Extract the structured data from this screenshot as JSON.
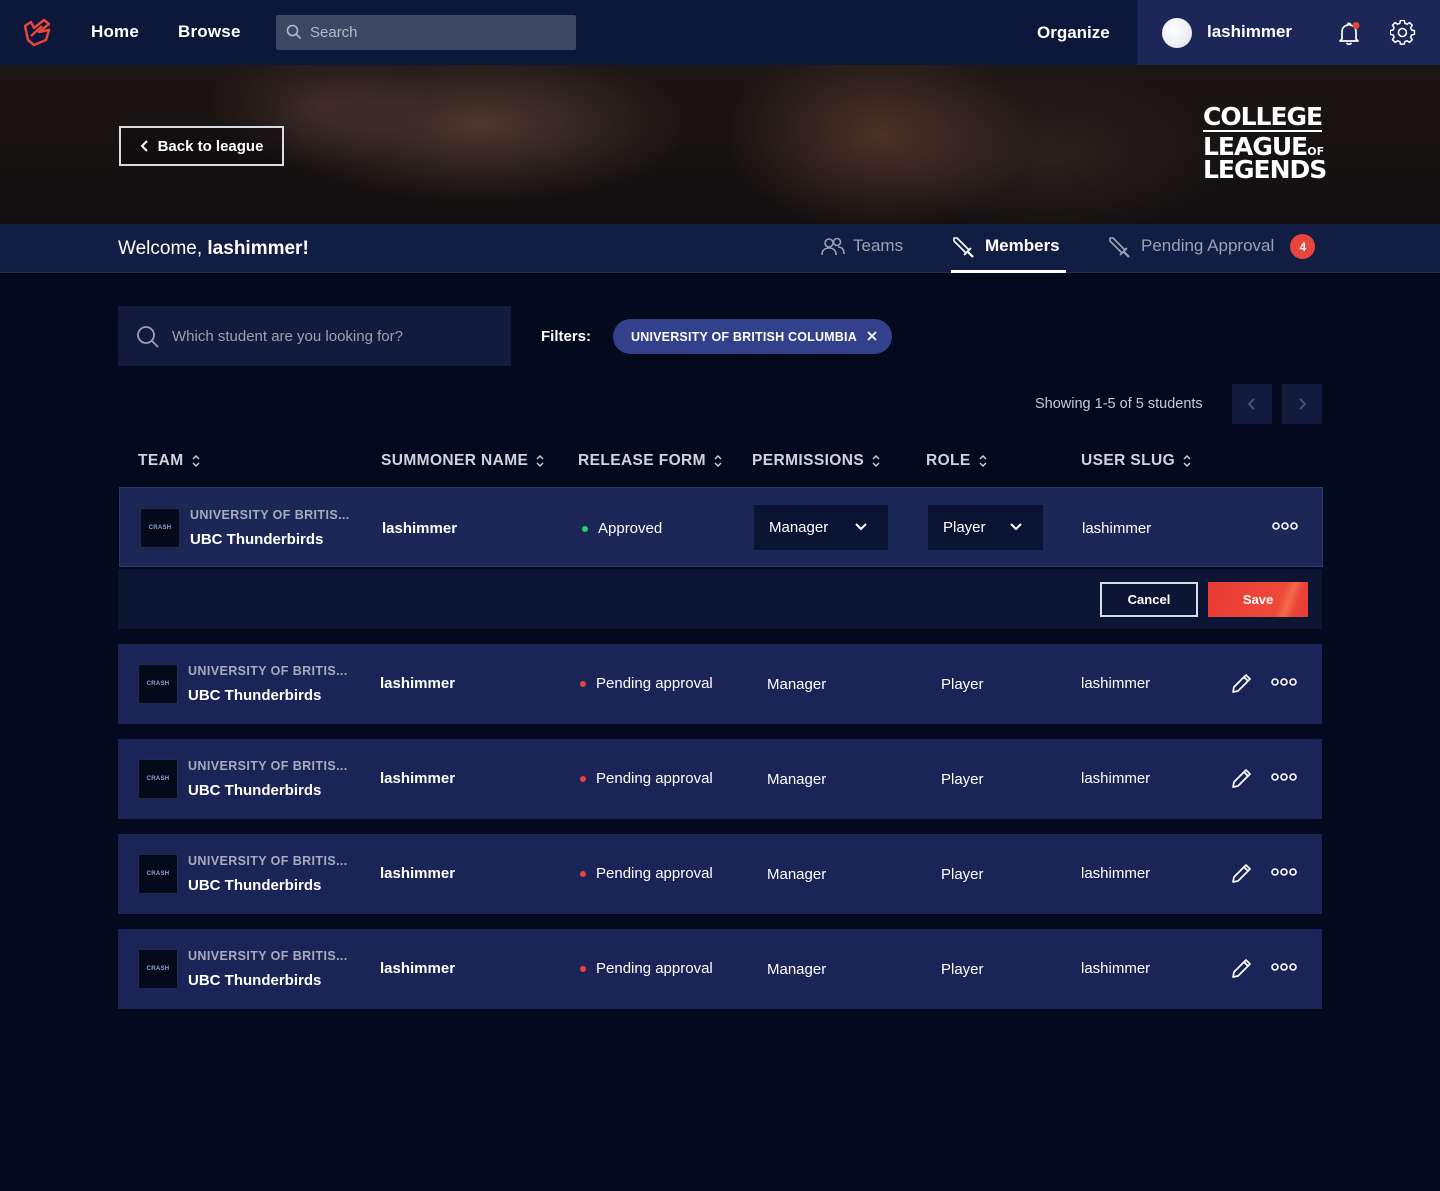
{
  "nav": {
    "logo_icon": "riot-fist-icon",
    "links": [
      "Home",
      "Browse"
    ],
    "search_placeholder": "Search",
    "organize": "Organize",
    "username": "lashimmer",
    "notification_dot_color": "#e8453c"
  },
  "banner": {
    "back_label": "Back to league",
    "logo_line1": "COLLEGE",
    "logo_line2": "LEAGUE",
    "logo_line2_small": "OF",
    "logo_line3": "LEGENDS"
  },
  "subheader": {
    "welcome_prefix": "Welcome, ",
    "welcome_name": "lashimmer",
    "welcome_suffix": "!",
    "tabs": [
      {
        "label": "Teams",
        "icon": "users-icon",
        "active": false
      },
      {
        "label": "Members",
        "icon": "sword-icon",
        "active": true
      },
      {
        "label": "Pending Approval",
        "icon": "sword-icon",
        "active": false,
        "badge": "4"
      }
    ]
  },
  "filters": {
    "search_placeholder": "Which student are you looking for?",
    "label": "Filters:",
    "chip": "UNIVERSITY OF BRITISH COLUMBIA",
    "showing": "Showing 1-5 of 5 students"
  },
  "table": {
    "headers": [
      "TEAM",
      "SUMMONER NAME",
      "RELEASE FORM",
      "PERMISSIONS",
      "ROLE",
      "USER SLUG"
    ],
    "rows": [
      {
        "school": "UNIVERSITY OF BRITIS...",
        "team": "UBC Thunderbirds",
        "summoner": "lashimmer",
        "release": "Approved",
        "release_color": "#2ecc71",
        "permissions": "Manager",
        "role": "Player",
        "slug": "lashimmer",
        "editing": true
      },
      {
        "school": "UNIVERSITY OF BRITIS...",
        "team": "UBC Thunderbirds",
        "summoner": "lashimmer",
        "release": "Pending approval",
        "release_color": "#e8453c",
        "permissions": "Manager",
        "role": "Player",
        "slug": "lashimmer",
        "editing": false
      },
      {
        "school": "UNIVERSITY OF BRITIS...",
        "team": "UBC Thunderbirds",
        "summoner": "lashimmer",
        "release": "Pending approval",
        "release_color": "#e8453c",
        "permissions": "Manager",
        "role": "Player",
        "slug": "lashimmer",
        "editing": false
      },
      {
        "school": "UNIVERSITY OF BRITIS...",
        "team": "UBC Thunderbirds",
        "summoner": "lashimmer",
        "release": "Pending approval",
        "release_color": "#e8453c",
        "permissions": "Manager",
        "role": "Player",
        "slug": "lashimmer",
        "editing": false
      },
      {
        "school": "UNIVERSITY OF BRITIS...",
        "team": "UBC Thunderbirds",
        "summoner": "lashimmer",
        "release": "Pending approval",
        "release_color": "#e8453c",
        "permissions": "Manager",
        "role": "Player",
        "slug": "lashimmer",
        "editing": false
      }
    ],
    "team_logo_text": "CRASH",
    "cancel_label": "Cancel",
    "save_label": "Save"
  }
}
